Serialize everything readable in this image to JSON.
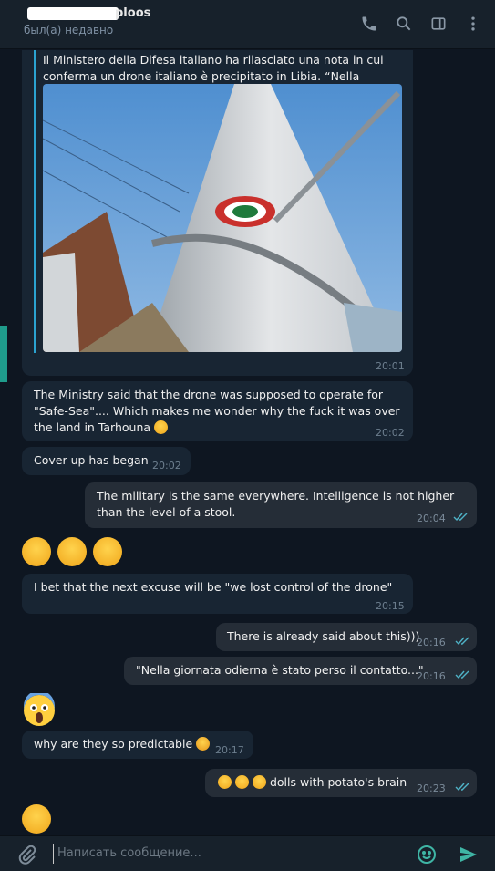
{
  "header": {
    "title_suffix": "ploos",
    "status": "был(а) недавно",
    "icons": [
      "phone-icon",
      "search-icon",
      "sidebar-icon",
      "more-icon"
    ]
  },
  "messages": {
    "forwarded": {
      "text": "Il Ministero della Difesa italiano ha rilasciato una nota in cui conferma un drone italiano è precipitato in Libia. “Nella giornata ...",
      "time": "20:01"
    },
    "m1": {
      "text": "The Ministry said that the drone was supposed to operate for \"Safe-Sea\".... Which makes me wonder why the fuck it was over the land in Tarhouna",
      "time": "20:02"
    },
    "m2": {
      "text": "Cover up has began",
      "time": "20:02"
    },
    "m3": {
      "text": "The military is the same everywhere. Intelligence is not higher than the level of a stool.",
      "time": "20:04"
    },
    "m4": {
      "text": "I bet that the next excuse will be \"we lost control of the drone\"",
      "time": "20:15"
    },
    "m5": {
      "text": "There is already said about this)))",
      "time": "20:16"
    },
    "m6": {
      "text": "\"Nella giornata odierna è stato perso il contatto...\"",
      "time": "20:16"
    },
    "m7": {
      "text": "why are they so predictable",
      "time": "20:17"
    },
    "m8": {
      "text": "dolls with potato's brain",
      "time": "20:23"
    }
  },
  "composer": {
    "placeholder": "Написать сообщение..."
  },
  "colors": {
    "background": "#0e1621",
    "incoming": "#182533",
    "outgoing": "#252d37",
    "accent": "#2ba3d1",
    "send": "#3fb5a5"
  }
}
